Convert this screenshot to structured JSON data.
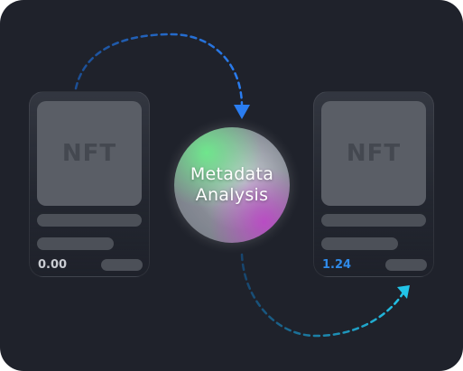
{
  "nodes": {
    "left_card": {
      "thumb_label": "NFT",
      "price": "0.00"
    },
    "center": {
      "label_line1": "Metadata",
      "label_line2": "Analysis"
    },
    "right_card": {
      "thumb_label": "NFT",
      "price": "1.24"
    }
  },
  "colors": {
    "background": "#1f222b",
    "arrow_top": "#2a7df0",
    "arrow_bottom": "#22c4e8",
    "price_highlight": "#2f8ae8",
    "orb_green": "#6eeb8c",
    "orb_purple": "#be46c8"
  }
}
